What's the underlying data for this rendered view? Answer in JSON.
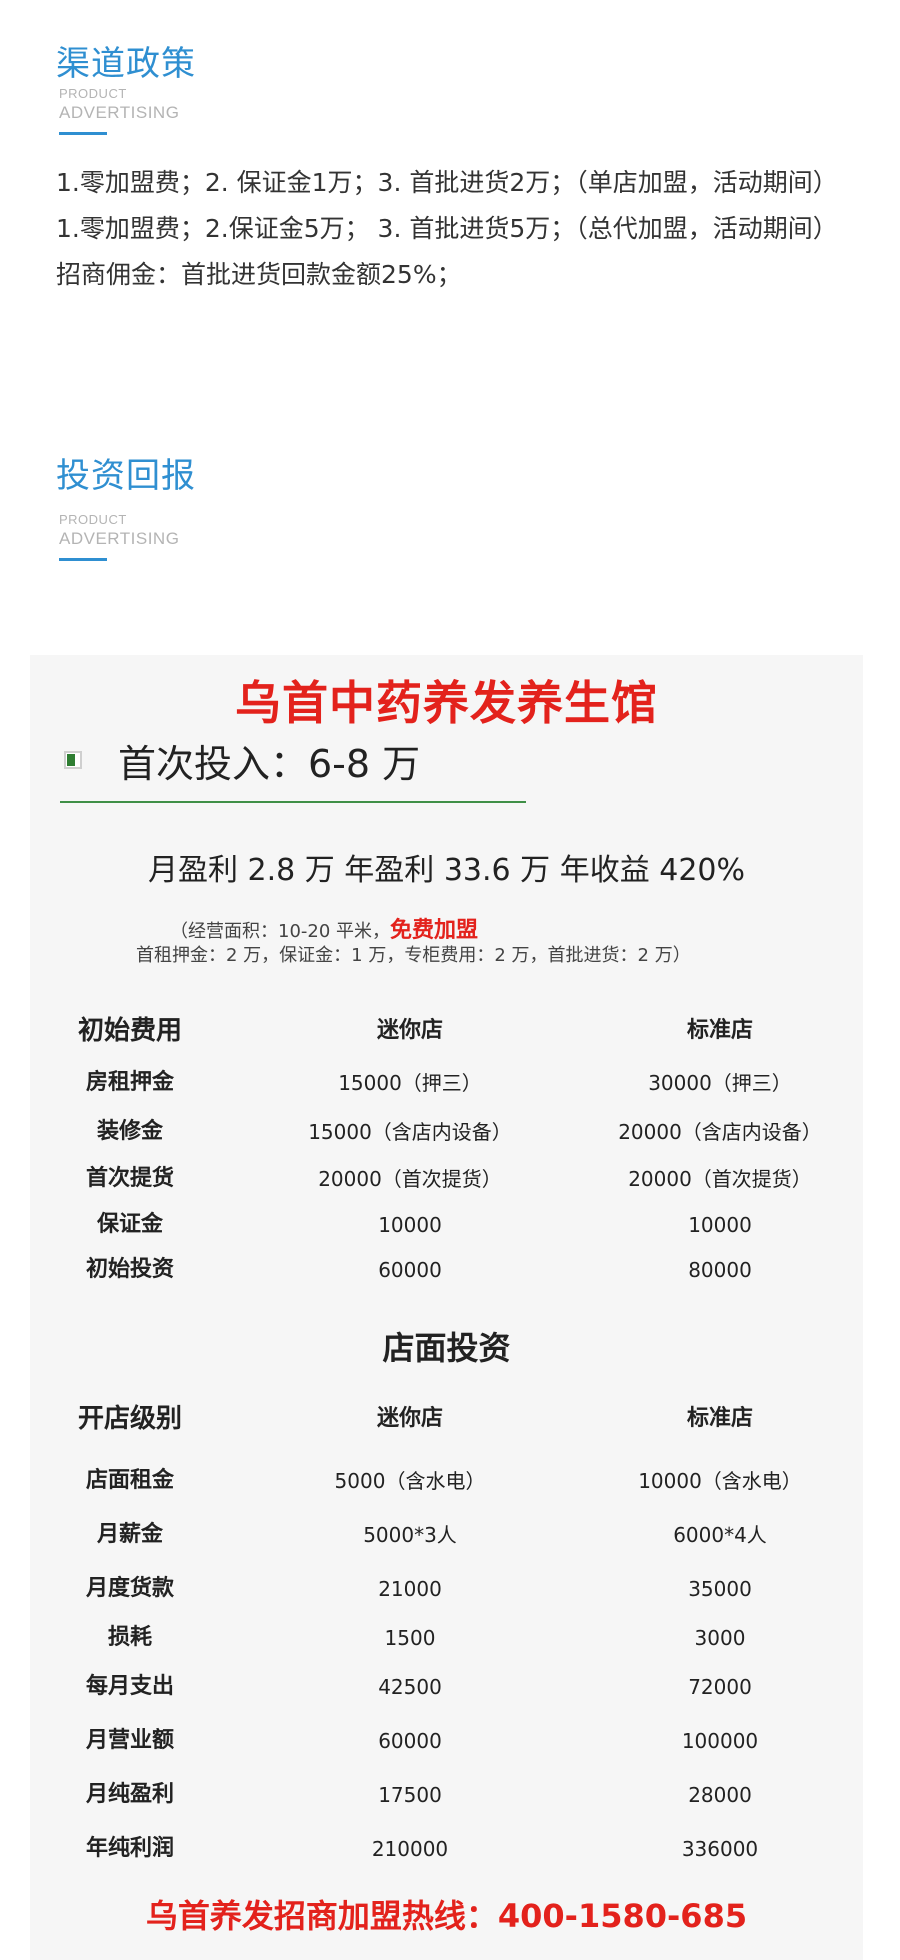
{
  "colors": {
    "accent": "#2f8fd1",
    "poster_red": "#e3221c",
    "poster_green": "#3f8f47"
  },
  "policy_section": {
    "title": "渠道政策",
    "sub1": "PRODUCT",
    "sub2": "ADVERTISING",
    "lines": [
      " 1.零加盟费；2. 保证金1万；3. 首批进货2万；（单店加盟，活动期间）",
      " 1.零加盟费；2.保证金5万；  3. 首批进货5万；（总代加盟，活动期间）",
      "招商佣金：首批进货回款金额25%；"
    ]
  },
  "return_section": {
    "title": "投资回报",
    "sub1": "PRODUCT",
    "sub2": "ADVERTISING"
  },
  "poster": {
    "title": "乌首中药养发养生馆",
    "first_invest": "首次投入：6-8 万",
    "profit_line": "月盈利 2.8 万 年盈利 33.6 万 年收益 420%",
    "note1_prefix": "（经营面积：10-20 平米，",
    "note1_free": "免费加盟",
    "note2": "首租押金：2 万，保证金：1 万，专柜费用：2 万，首批进货：2 万）",
    "initial_table": {
      "header": [
        "初始费用",
        "迷你店",
        "标准店"
      ],
      "rows": [
        [
          "房租押金",
          "15000（押三）",
          "30000（押三）"
        ],
        [
          "装修金",
          "15000（含店内设备）",
          "20000（含店内设备）"
        ],
        [
          "首次提货",
          "20000（首次提货）",
          "20000（首次提货）"
        ],
        [
          "保证金",
          "10000",
          "10000"
        ],
        [
          "初始投资",
          "60000",
          "80000"
        ]
      ]
    },
    "mid_title": "店面投资",
    "store_table": {
      "header": [
        "开店级别",
        "迷你店",
        "标准店"
      ],
      "rows": [
        [
          "店面租金",
          "5000（含水电）",
          "10000（含水电）"
        ],
        [
          "月薪金",
          "5000*3人",
          "6000*4人"
        ],
        [
          "月度货款",
          "21000",
          "35000"
        ],
        [
          "损耗",
          "1500",
          "3000"
        ],
        [
          "每月支出",
          "42500",
          "72000"
        ],
        [
          "月营业额",
          "60000",
          "100000"
        ],
        [
          "月纯盈利",
          "17500",
          "28000"
        ],
        [
          "年纯利润",
          "210000",
          "336000"
        ]
      ]
    },
    "hotline": "乌首养发招商加盟热线：400-1580-685"
  }
}
